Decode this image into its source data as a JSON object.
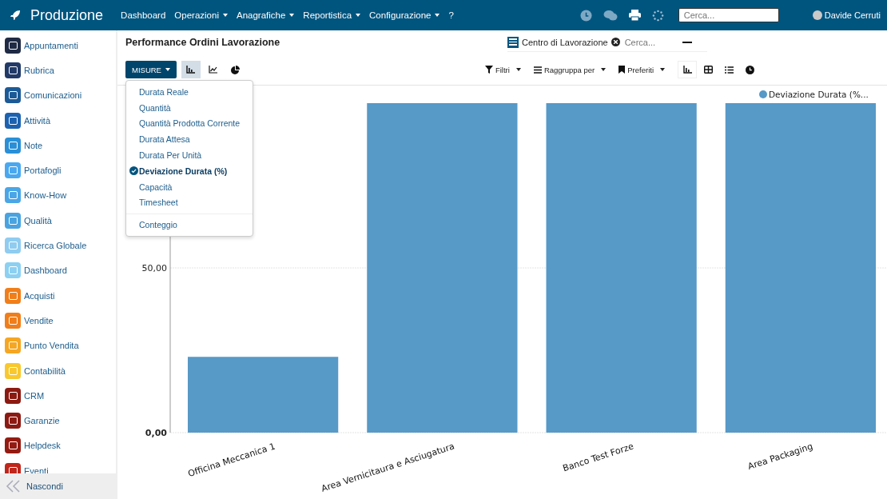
{
  "navbar": {
    "brand": "Produzione",
    "menu": [
      {
        "label": "Dashboard",
        "dropdown": false
      },
      {
        "label": "Operazioni",
        "dropdown": true
      },
      {
        "label": "Anagrafiche",
        "dropdown": true
      },
      {
        "label": "Reportistica",
        "dropdown": true
      },
      {
        "label": "Configurazione",
        "dropdown": true
      },
      {
        "label": "?",
        "dropdown": false
      }
    ],
    "search": {
      "placeholder": "Cerca..."
    },
    "user": "Davide Cerruti"
  },
  "sidebar": {
    "items": [
      {
        "label": "Appuntamenti",
        "color": "#1f2a44"
      },
      {
        "label": "Rubrica",
        "color": "#213a67"
      },
      {
        "label": "Comunicazioni",
        "color": "#1b5a96"
      },
      {
        "label": "Attività",
        "color": "#1c62b0"
      },
      {
        "label": "Note",
        "color": "#2a8fd6"
      },
      {
        "label": "Portafogli",
        "color": "#4aa8f0"
      },
      {
        "label": "Know-How",
        "color": "#4aa6e6"
      },
      {
        "label": "Qualità",
        "color": "#49a3e0"
      },
      {
        "label": "Ricerca Globale",
        "color": "#8fccf0"
      },
      {
        "label": "Dashboard",
        "color": "#8cd0f2"
      },
      {
        "label": "Acquisti",
        "color": "#f07e1a"
      },
      {
        "label": "Vendite",
        "color": "#f07e1a"
      },
      {
        "label": "Punto Vendita",
        "color": "#f5a623"
      },
      {
        "label": "Contabilità",
        "color": "#f8c82e"
      },
      {
        "label": "CRM",
        "color": "#8b1a12"
      },
      {
        "label": "Garanzie",
        "color": "#8b1a12"
      },
      {
        "label": "Helpdesk",
        "color": "#941b12"
      },
      {
        "label": "Eventi",
        "color": "#c0261b"
      }
    ],
    "footer": "Nascondi"
  },
  "page": {
    "title": "Performance Ordini Lavorazione",
    "measures_button": "MISURE",
    "chart_types": [
      {
        "kind": "bar",
        "selected": true
      },
      {
        "kind": "line",
        "selected": false
      },
      {
        "kind": "pie",
        "selected": false
      }
    ],
    "facet": {
      "label": "Centro di Lavorazione"
    },
    "search": {
      "placeholder": "Cerca..."
    },
    "filters": [
      {
        "kind": "filter",
        "label": "Filtri"
      },
      {
        "kind": "group",
        "label": "Raggruppa per"
      },
      {
        "kind": "favorite",
        "label": "Preferiti"
      }
    ],
    "views": [
      {
        "kind": "graph",
        "selected": true
      },
      {
        "kind": "pivot",
        "selected": false
      },
      {
        "kind": "list",
        "selected": false
      },
      {
        "kind": "activity",
        "selected": false
      }
    ]
  },
  "measures_menu": {
    "items": [
      {
        "label": "Durata Reale",
        "selected": false
      },
      {
        "label": "Quantità",
        "selected": false
      },
      {
        "label": "Quantità Prodotta Corrente",
        "selected": false
      },
      {
        "label": "Durata Attesa",
        "selected": false
      },
      {
        "label": "Durata Per Unità",
        "selected": false
      },
      {
        "label": "Deviazione Durata (%)",
        "selected": true
      },
      {
        "label": "Capacità",
        "selected": false
      },
      {
        "label": "Timesheet",
        "selected": false
      }
    ],
    "count_item": "Conteggio"
  },
  "chart": {
    "chart_data": {
      "type": "bar",
      "categories": [
        "Officina Meccanica 1",
        "Area Vernicitaura e Asciugatura",
        "Banco Test Forze",
        "Area Packaging"
      ],
      "series": [
        {
          "name": "Deviazione Durata (%...",
          "color": "#5799c7",
          "values": [
            23,
            100,
            100,
            100
          ]
        }
      ],
      "ylim": [
        0,
        100
      ],
      "yticks": [
        {
          "value": 0,
          "label": "0,00"
        },
        {
          "value": 50,
          "label": "50,00"
        }
      ]
    }
  }
}
